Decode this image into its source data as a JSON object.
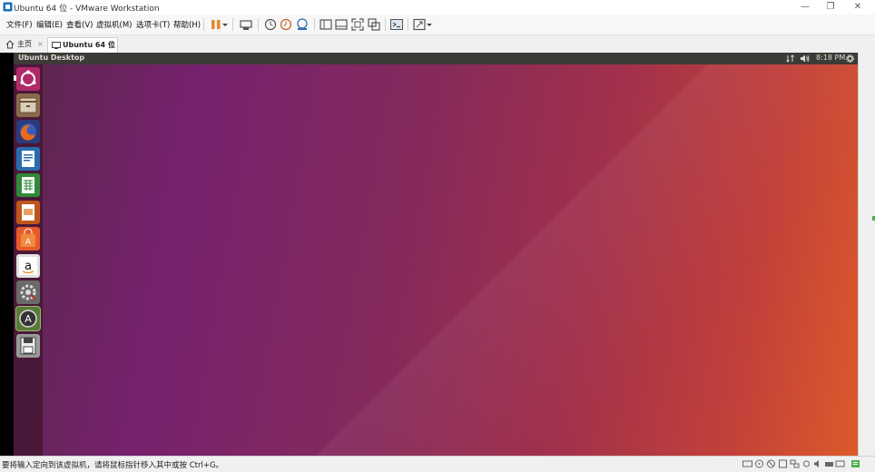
{
  "window": {
    "title": "Ubuntu 64 位 - VMware Workstation",
    "controls": {
      "minimize": "—",
      "restore": "❐",
      "close": "✕"
    }
  },
  "menu": {
    "items": [
      "文件(F)",
      "编辑(E)",
      "查看(V)",
      "虚拟机(M)",
      "选项卡(T)",
      "帮助(H)"
    ]
  },
  "toolbar": {
    "icons": [
      "pause-icon",
      "dropdown-icon",
      "send-ctrl-alt-del-icon",
      "snapshot-icon",
      "revert-snapshot-icon",
      "snapshot-manager-icon",
      "library-icon",
      "thumbnail-icon",
      "fullscreen-icon",
      "unity-icon",
      "console-icon",
      "stretch-icon",
      "dropdown-icon"
    ]
  },
  "tabs": [
    {
      "label": "主页",
      "icon": "home-icon",
      "close": "×"
    },
    {
      "label": "Ubuntu 64 位",
      "icon": "vm-icon",
      "close": "×"
    }
  ],
  "ubuntu": {
    "topbar_title": "Ubuntu Desktop",
    "time": "8:18 PM",
    "launcher": [
      {
        "name": "dash",
        "color": "#b02a6a"
      },
      {
        "name": "files",
        "color": "#8a6a4a"
      },
      {
        "name": "firefox",
        "color": "#e06a1a"
      },
      {
        "name": "libreoffice-writer",
        "color": "#2a6cb0"
      },
      {
        "name": "libreoffice-calc",
        "color": "#2f8a3a"
      },
      {
        "name": "libreoffice-impress",
        "color": "#c0561c"
      },
      {
        "name": "software-center",
        "color": "#e85a2a"
      },
      {
        "name": "amazon",
        "color": "#e0e0e0"
      },
      {
        "name": "system-settings",
        "color": "#8a8a8a"
      },
      {
        "name": "software-updater",
        "color": "#444444"
      },
      {
        "name": "floppy",
        "color": "#cfcfcf"
      }
    ]
  },
  "statusbar": {
    "message": "要将输入定向到该虚拟机，请将鼠标指针移入其中或按 Ctrl+G。"
  }
}
